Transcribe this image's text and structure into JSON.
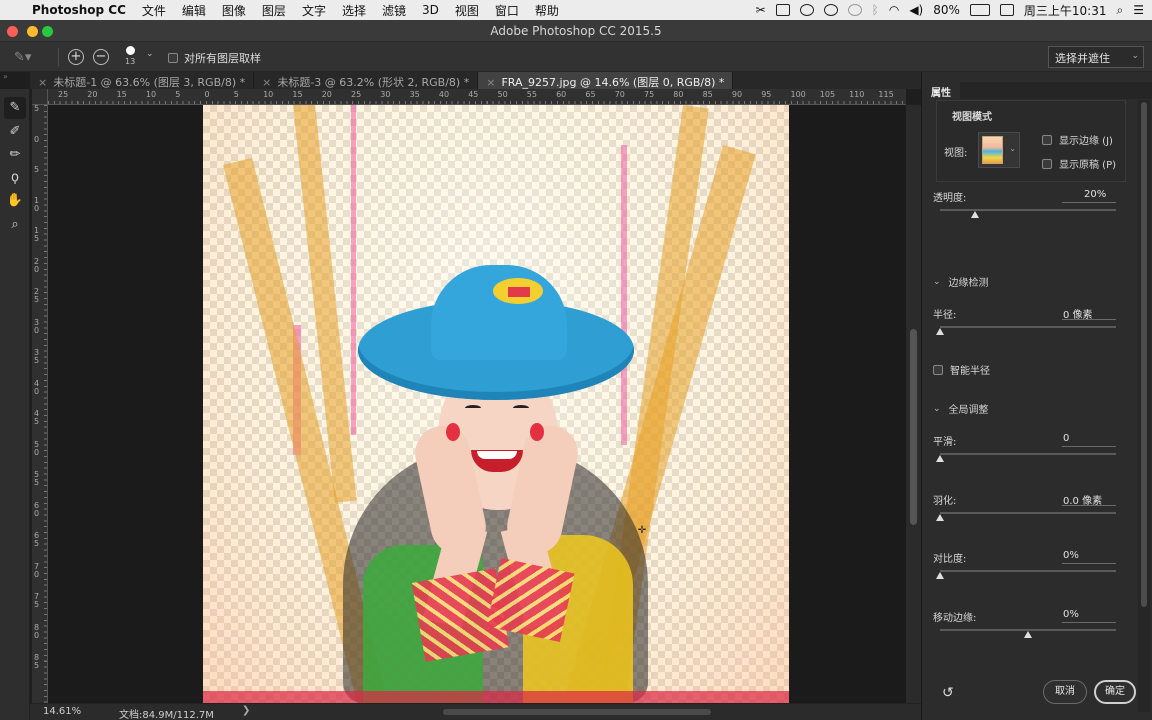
{
  "menubar": {
    "app_name": "Photoshop CC",
    "items": [
      "文件",
      "编辑",
      "图像",
      "图层",
      "文字",
      "选择",
      "滤镜",
      "3D",
      "视图",
      "窗口",
      "帮助"
    ],
    "battery": "80%",
    "clock": "周三上午10:31"
  },
  "window": {
    "title": "Adobe Photoshop CC 2015.5"
  },
  "options": {
    "brush_size": "13",
    "sample_all_layers": "对所有图层取样",
    "select_and_mask": "选择并遮住"
  },
  "tabs": [
    {
      "label": "未标题-1 @ 63.6% (图层 3, RGB/8) *",
      "active": false
    },
    {
      "label": "未标题-3 @ 63.2% (形状 2, RGB/8) *",
      "active": false
    },
    {
      "label": "FRA_9257.jpg @ 14.6% (图层 0, RGB/8) *",
      "active": true
    }
  ],
  "ruler_h": [
    "25",
    "20",
    "15",
    "10",
    "5",
    "0",
    "5",
    "10",
    "15",
    "20",
    "25",
    "30",
    "35",
    "40",
    "45",
    "50",
    "55",
    "60",
    "65",
    "70",
    "75",
    "80",
    "85",
    "90",
    "95",
    "100",
    "105",
    "110",
    "115"
  ],
  "ruler_v": [
    "5",
    "0",
    "5",
    "1 0",
    "1 5",
    "2 0",
    "2 5",
    "3 0",
    "3 5",
    "4 0",
    "4 5",
    "5 0",
    "5 5",
    "6 0",
    "6 5",
    "7 0",
    "7 5",
    "8 0",
    "8 5"
  ],
  "status": {
    "zoom": "14.61%",
    "doc": "文档:84.9M/112.7M",
    "arrow": "❯"
  },
  "panel": {
    "tab": "属性",
    "view_mode": "视图模式",
    "view_label": "视图:",
    "show_edge": "显示边缘 (J)",
    "show_original": "显示原稿 (P)",
    "opacity_label": "透明度:",
    "opacity_value": "20%",
    "edge_detection": "边缘检测",
    "radius_label": "半径:",
    "radius_value": "0 像素",
    "smart_radius": "智能半径",
    "global_refine": "全局调整",
    "smooth_label": "平滑:",
    "smooth_value": "0",
    "feather_label": "羽化:",
    "feather_value": "0.0 像素",
    "contrast_label": "对比度:",
    "contrast_value": "0%",
    "shift_edge_label": "移动边缘:",
    "shift_edge_value": "0%",
    "cancel": "取消",
    "ok": "确定"
  },
  "slider_values": {
    "opacity": 0.2,
    "radius": 0,
    "smooth": 0,
    "feather": 0,
    "contrast": 0,
    "shift_edge": 0
  }
}
